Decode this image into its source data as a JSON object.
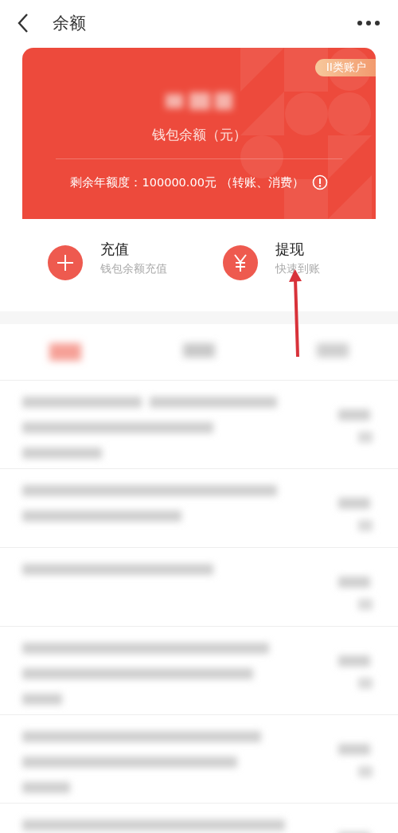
{
  "header": {
    "title": "余额"
  },
  "card": {
    "badge": "II类账户",
    "label": "钱包余额（元）",
    "limit": "剩余年额度：100000.00元 （转账、消费）"
  },
  "actions": [
    {
      "kind": "plus",
      "title": "充值",
      "subtitle": "钱包余额充值"
    },
    {
      "kind": "yen",
      "title": "提现",
      "subtitle": "快速到账"
    }
  ]
}
